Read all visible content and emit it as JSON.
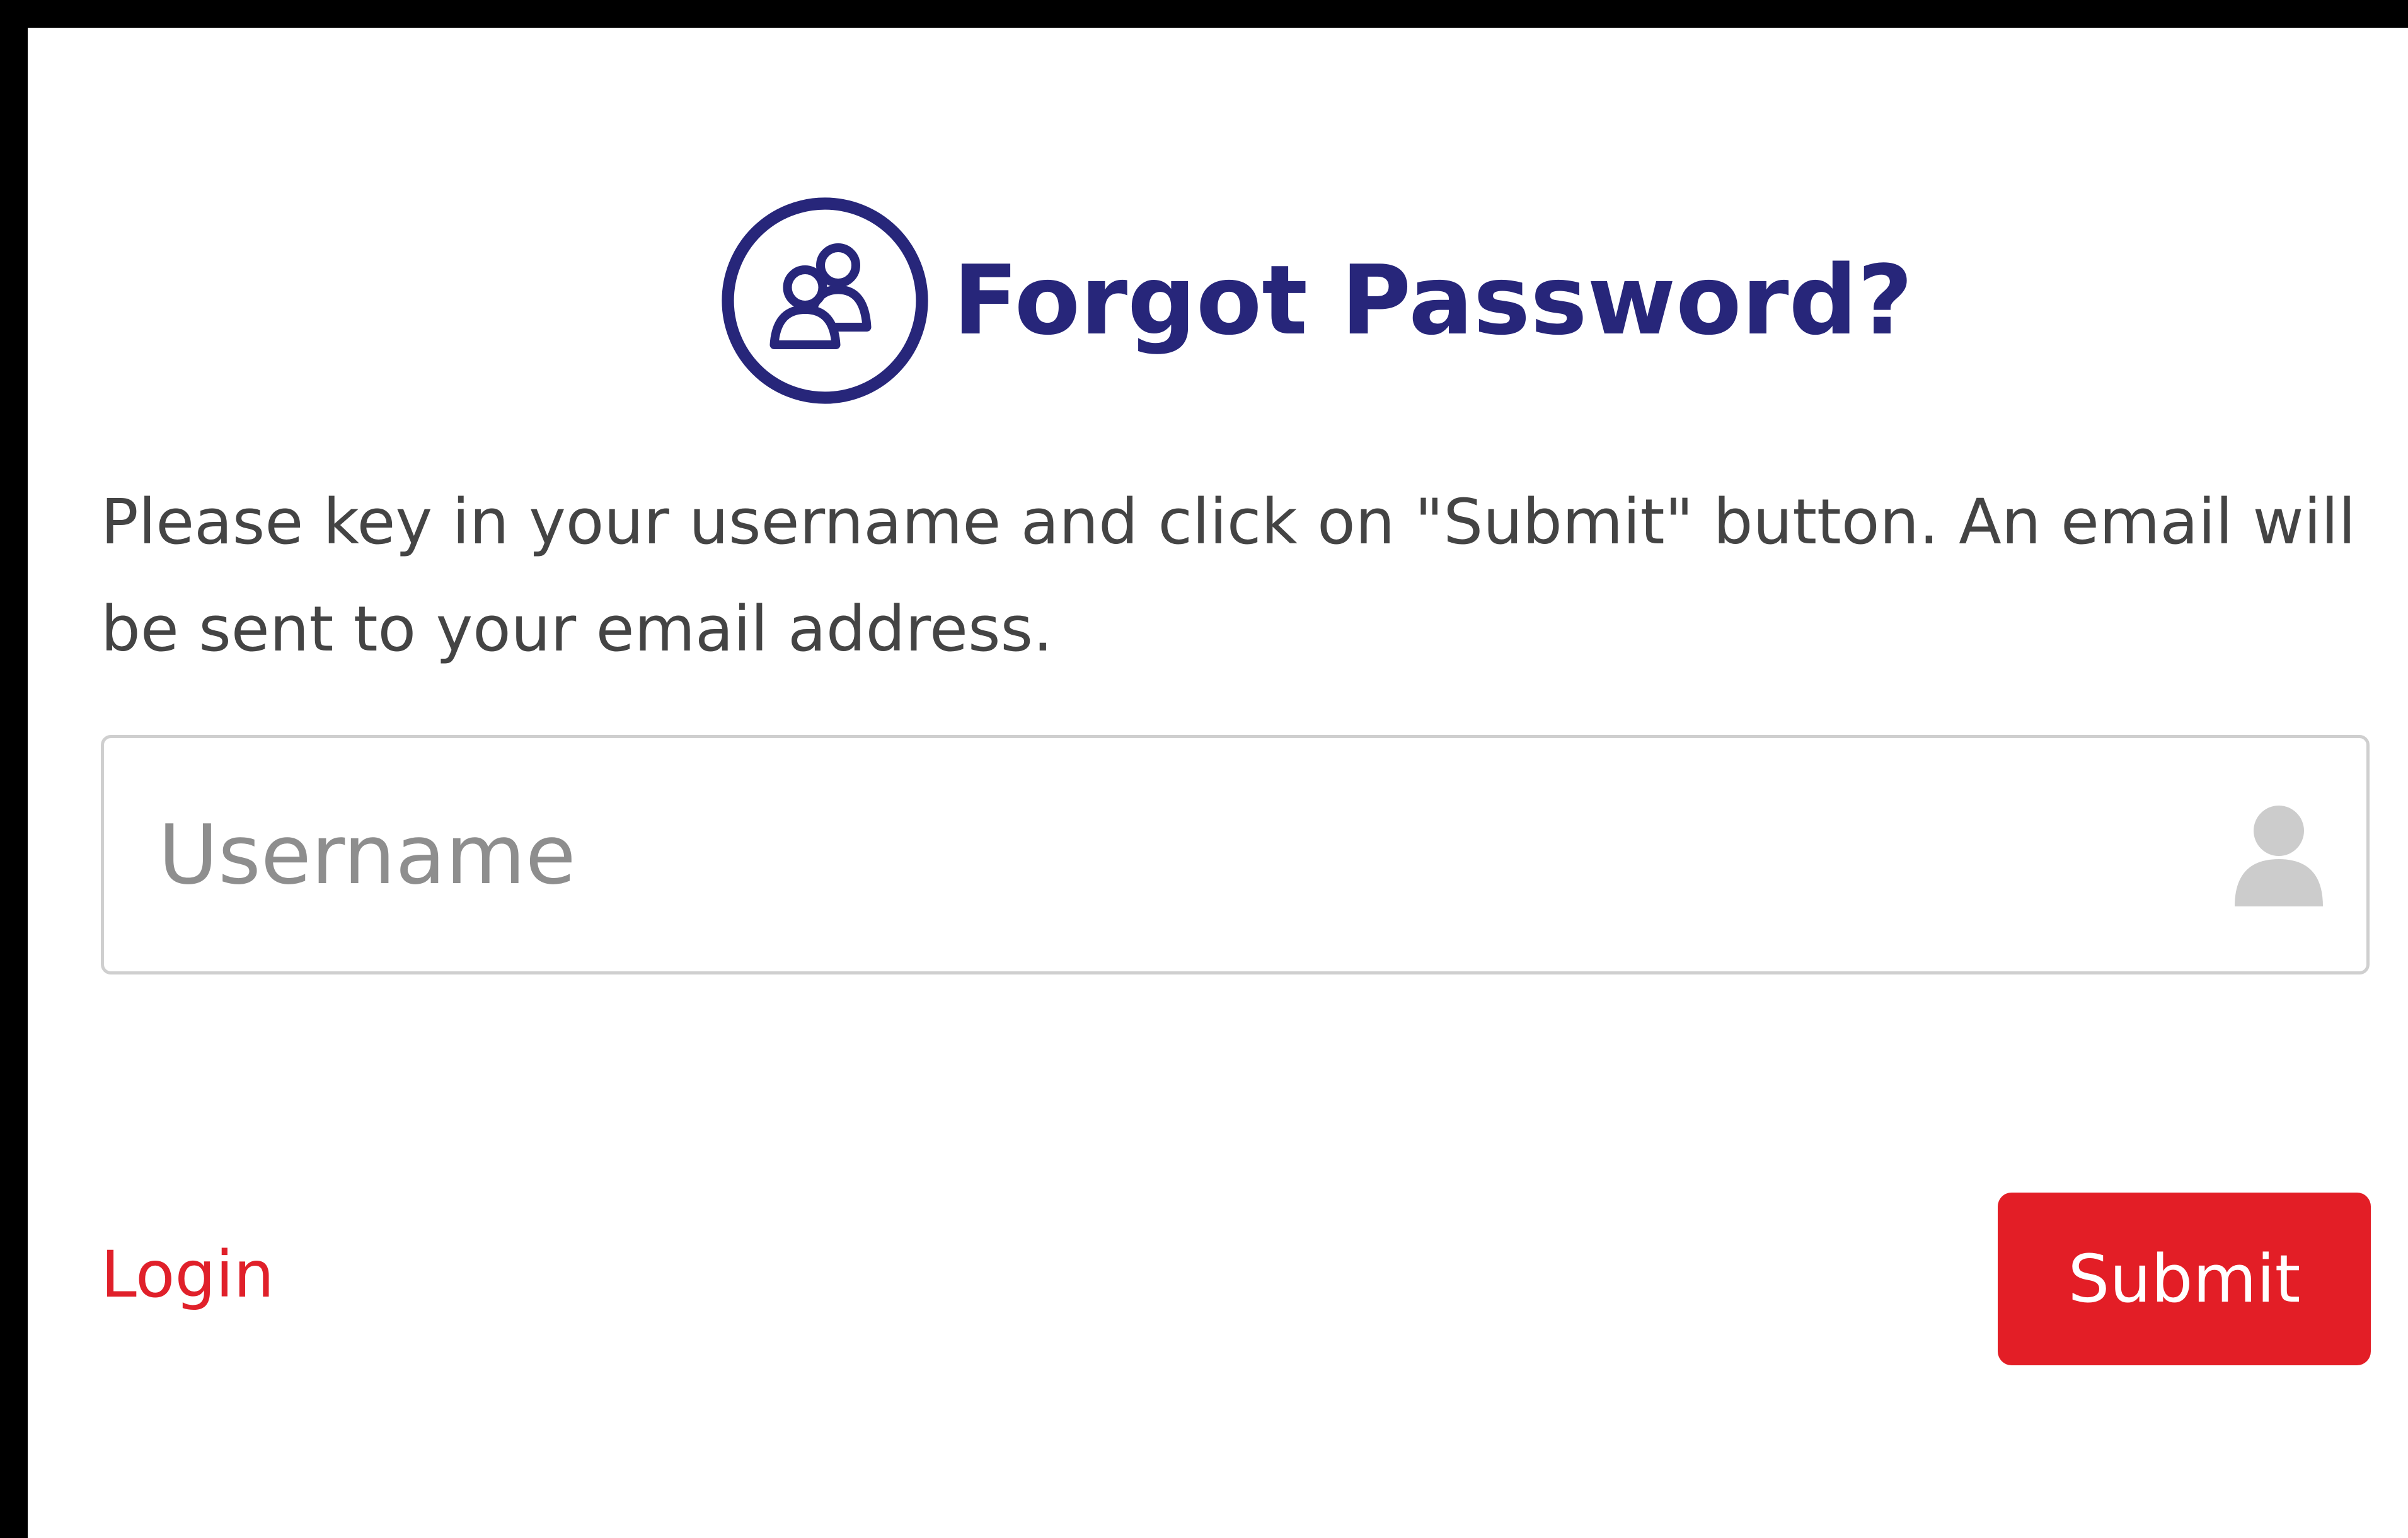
{
  "page": {
    "title": "Forgot Password?",
    "instructions": "Please key in your username and click on \"Submit\" button. An email will be sent to your email address."
  },
  "form": {
    "username": {
      "value": "",
      "placeholder": "Username",
      "icon": "user-icon"
    },
    "login_link_label": "Login",
    "submit_label": "Submit"
  },
  "icons": {
    "header": "users-circle-icon"
  },
  "colors": {
    "title": "#27267a",
    "accent_red": "#e31e26",
    "link_red": "#e0202a",
    "frame": "#000000",
    "input_border": "#cfcfcf",
    "placeholder": "#8e8e8e",
    "body_text": "#444444"
  }
}
